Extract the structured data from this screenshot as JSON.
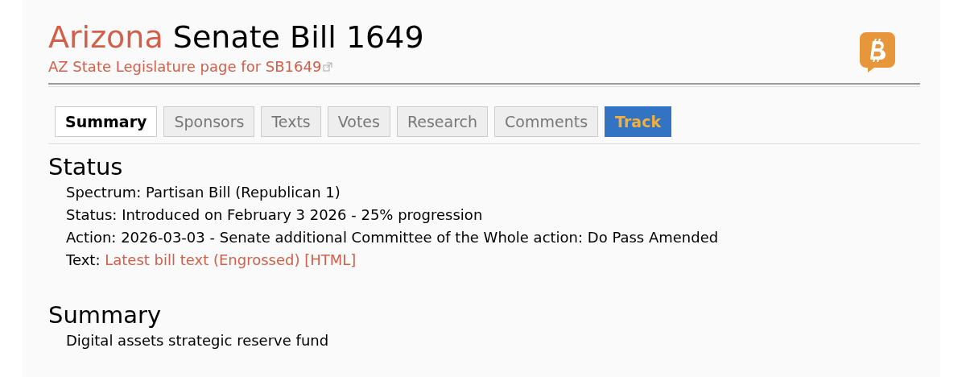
{
  "header": {
    "state": "Arizona",
    "title": "Senate Bill 1649",
    "link": "AZ State Legislature page for SB1649"
  },
  "tabs": [
    {
      "label": "Summary",
      "selected": true,
      "kind": "tab"
    },
    {
      "label": "Sponsors",
      "selected": false,
      "kind": "tab"
    },
    {
      "label": "Texts",
      "selected": false,
      "kind": "tab"
    },
    {
      "label": "Votes",
      "selected": false,
      "kind": "tab"
    },
    {
      "label": "Research",
      "selected": false,
      "kind": "tab"
    },
    {
      "label": "Comments",
      "selected": false,
      "kind": "tab"
    },
    {
      "label": "Track",
      "selected": false,
      "kind": "action"
    }
  ],
  "status": {
    "heading": "Status",
    "lines": [
      {
        "label": "Spectrum:",
        "value": "Partisan Bill (Republican 1)"
      },
      {
        "label": "Status:",
        "value": "Introduced on February 3 2026 - 25% progression"
      },
      {
        "label": "Action:",
        "value": "2026-03-03 - Senate additional Committee of the Whole action: Do Pass Amended"
      },
      {
        "label": "Text:",
        "link": "Latest bill text (Engrossed) [HTML]"
      }
    ]
  },
  "summary": {
    "heading": "Summary",
    "text": "Digital assets strategic reserve fund"
  }
}
